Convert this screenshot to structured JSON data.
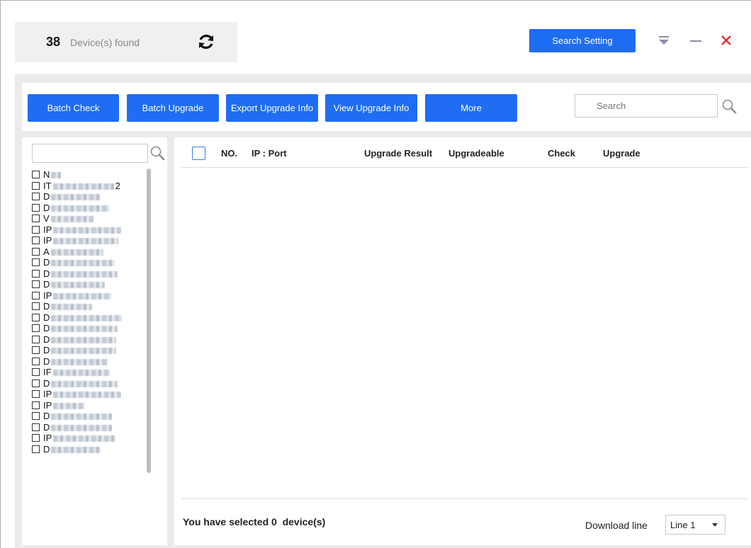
{
  "header": {
    "count": "38",
    "found_label": "Device(s) found",
    "search_setting_label": "Search Setting"
  },
  "toolbar": {
    "batch_check": "Batch Check",
    "batch_upgrade": "Batch Upgrade",
    "export_upgrade_info": "Export Upgrade Info",
    "view_upgrade_info": "View Upgrade Info",
    "more": "More",
    "search_placeholder": "Search"
  },
  "device_list": {
    "items": [
      {
        "prefix": "N"
      },
      {
        "prefix": "IT",
        "suffix": "2"
      },
      {
        "prefix": "D"
      },
      {
        "prefix": "D"
      },
      {
        "prefix": "V"
      },
      {
        "prefix": "IP"
      },
      {
        "prefix": "IP"
      },
      {
        "prefix": "A"
      },
      {
        "prefix": "D"
      },
      {
        "prefix": "D"
      },
      {
        "prefix": "D"
      },
      {
        "prefix": "IP"
      },
      {
        "prefix": "D"
      },
      {
        "prefix": "D"
      },
      {
        "prefix": "D"
      },
      {
        "prefix": "D"
      },
      {
        "prefix": "D"
      },
      {
        "prefix": "D"
      },
      {
        "prefix": "IF"
      },
      {
        "prefix": "D"
      },
      {
        "prefix": "IP"
      },
      {
        "prefix": "IP"
      },
      {
        "prefix": "D"
      },
      {
        "prefix": "D"
      },
      {
        "prefix": "IP"
      },
      {
        "prefix": "D"
      }
    ]
  },
  "table": {
    "headers": {
      "no": "NO.",
      "ip_port": "IP : Port",
      "upgrade_result": "Upgrade Result",
      "upgradeable": "Upgradeable",
      "check": "Check",
      "upgrade": "Upgrade"
    }
  },
  "footer": {
    "selected_text": "You have selected 0  device(s)",
    "download_line_label": "Download line",
    "download_line_value": "Line 1"
  },
  "colors": {
    "accent": "#1f6df2",
    "close": "#e0302f"
  }
}
